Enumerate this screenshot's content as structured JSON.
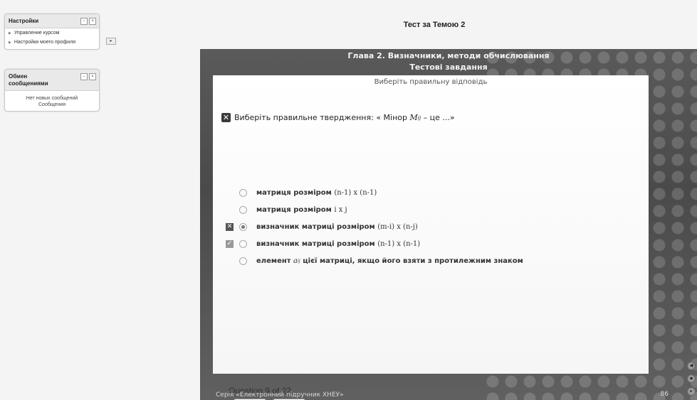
{
  "sidebar": {
    "settings_block": {
      "title": "Настройки",
      "items": [
        {
          "label": "Управление курсом"
        },
        {
          "label": "Настройки моего профиля"
        }
      ]
    },
    "messages_block": {
      "title": "Обмен сообщениями",
      "empty_text": "Нет новых сообщений",
      "link": "Сообщения"
    },
    "block_controls": [
      "−",
      "×"
    ],
    "dock_symbol": "▸"
  },
  "page": {
    "title": "Тест за Темою 2"
  },
  "book": {
    "header_line1": "Глава 2. Визначники, методи обчислювання",
    "header_line2": "Тестові завдання",
    "subtitle": "Виберіть правильну відповідь",
    "question": {
      "prefix": "Виберіть правильне твердження: « Мінор ",
      "symbol": "M",
      "subscript": "ij",
      "suffix": " – це ...»"
    },
    "options": [
      {
        "parts": [
          "матриця розміром ",
          "(n-1) x (n-1)"
        ],
        "status": "",
        "selected": false
      },
      {
        "parts": [
          "матриця розміром ",
          "i x j"
        ],
        "status": "",
        "selected": false
      },
      {
        "parts": [
          "визначник матриці розміром ",
          "(m-i) x (n-j)"
        ],
        "status": "wrong",
        "selected": true
      },
      {
        "parts": [
          "визначник матриці розміром ",
          "(n-1) x (n-1)"
        ],
        "status": "correct",
        "selected": false
      },
      {
        "parts": [
          "елемент ",
          "a",
          "ij",
          " цієї матриці, якщо його взяти з протилежним знаком"
        ],
        "status": "",
        "selected": false
      }
    ],
    "progress": "Question 9 of 22",
    "prev_label": "<<",
    "next_label": ">>",
    "series": "Серія «Електронний підручник ХНЕУ»",
    "page_number": "86",
    "marks": {
      "wrong": "✕",
      "correct": "✓"
    },
    "side_controls": [
      "◀",
      "▪",
      "▸"
    ]
  }
}
